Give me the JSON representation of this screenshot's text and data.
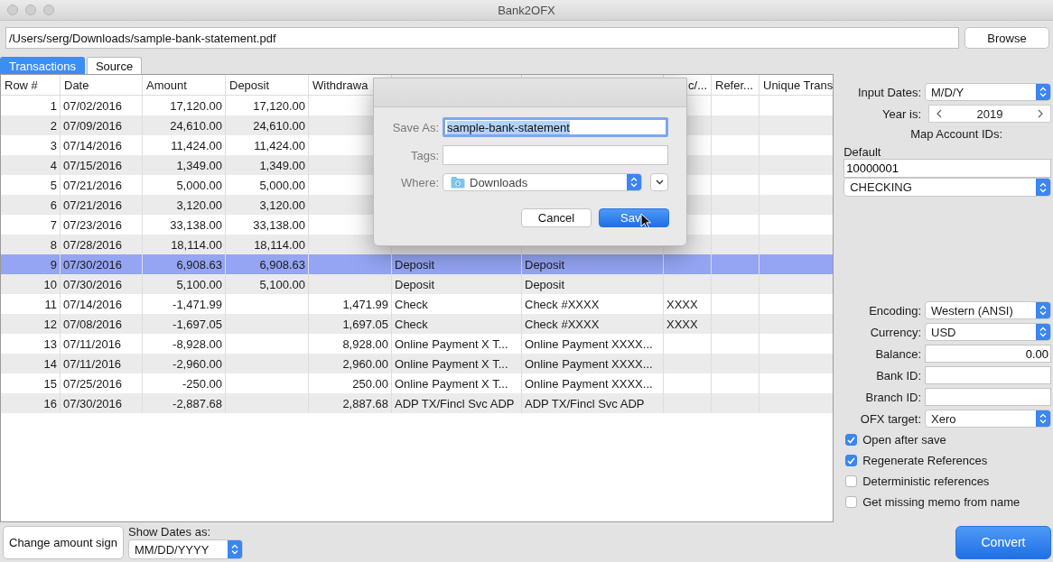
{
  "window": {
    "title": "Bank2OFX"
  },
  "file_path": {
    "value": "/Users/serg/Downloads/sample-bank-statement.pdf"
  },
  "browse_button": "Browse",
  "tabs": [
    {
      "label": "Transactions",
      "selected": true
    },
    {
      "label": "Source",
      "selected": false
    }
  ],
  "table": {
    "columns": [
      {
        "label": "Row #"
      },
      {
        "label": "Date"
      },
      {
        "label": "Amount"
      },
      {
        "label": "Deposit"
      },
      {
        "label": "Withdrawa"
      },
      {},
      {},
      {
        "label": "c/..."
      },
      {
        "label": "Refer..."
      },
      {
        "label": "Unique Trans"
      }
    ],
    "rows": [
      {
        "selected": false,
        "cells": [
          "1",
          "07/02/2016",
          "17,120.00",
          "17,120.00",
          null,
          null,
          null,
          null,
          null,
          null
        ]
      },
      {
        "selected": false,
        "cells": [
          "2",
          "07/09/2016",
          "24,610.00",
          "24,610.00",
          null,
          null,
          null,
          null,
          null,
          null
        ]
      },
      {
        "selected": false,
        "cells": [
          "3",
          "07/14/2016",
          "11,424.00",
          "11,424.00",
          null,
          null,
          null,
          null,
          null,
          null
        ]
      },
      {
        "selected": false,
        "cells": [
          "4",
          "07/15/2016",
          "1,349.00",
          "1,349.00",
          null,
          null,
          null,
          null,
          null,
          null
        ]
      },
      {
        "selected": false,
        "cells": [
          "5",
          "07/21/2016",
          "5,000.00",
          "5,000.00",
          null,
          null,
          null,
          null,
          null,
          null
        ]
      },
      {
        "selected": false,
        "cells": [
          "6",
          "07/21/2016",
          "3,120.00",
          "3,120.00",
          null,
          null,
          null,
          null,
          null,
          null
        ]
      },
      {
        "selected": false,
        "cells": [
          "7",
          "07/23/2016",
          "33,138.00",
          "33,138.00",
          null,
          null,
          null,
          null,
          null,
          null
        ]
      },
      {
        "selected": false,
        "cells": [
          "8",
          "07/28/2016",
          "18,114.00",
          "18,114.00",
          null,
          null,
          null,
          null,
          null,
          null
        ]
      },
      {
        "selected": true,
        "cells": [
          "9",
          "07/30/2016",
          "6,908.63",
          "6,908.63",
          null,
          "Deposit",
          "Deposit",
          null,
          null,
          null
        ]
      },
      {
        "selected": false,
        "cells": [
          "10",
          "07/30/2016",
          "5,100.00",
          "5,100.00",
          null,
          "Deposit",
          "Deposit",
          null,
          null,
          null
        ]
      },
      {
        "selected": false,
        "cells": [
          "11",
          "07/14/2016",
          "-1,471.99",
          null,
          "1,471.99",
          "Check",
          "Check #XXXX",
          "XXXX",
          null,
          null
        ]
      },
      {
        "selected": false,
        "cells": [
          "12",
          "07/08/2016",
          "-1,697.05",
          null,
          "1,697.05",
          "Check",
          "Check #XXXX",
          "XXXX",
          null,
          null
        ]
      },
      {
        "selected": false,
        "cells": [
          "13",
          "07/11/2016",
          "-8,928.00",
          null,
          "8,928.00",
          "Online Payment X T...",
          "Online Payment XXXX...",
          null,
          null,
          null
        ]
      },
      {
        "selected": false,
        "cells": [
          "14",
          "07/11/2016",
          "-2,960.00",
          null,
          "2,960.00",
          "Online Payment X T...",
          "Online Payment XXXX...",
          null,
          null,
          null
        ]
      },
      {
        "selected": false,
        "cells": [
          "15",
          "07/25/2016",
          "-250.00",
          null,
          "250.00",
          "Online Payment X T...",
          "Online Payment XXXX...",
          null,
          null,
          null
        ]
      },
      {
        "selected": false,
        "cells": [
          "16",
          "07/30/2016",
          "-2,887.68",
          null,
          "2,887.68",
          "ADP TX/Fincl Svc ADP",
          "ADP TX/Fincl Svc ADP",
          null,
          null,
          null
        ]
      }
    ]
  },
  "save_dialog": {
    "save_as": {
      "label": "Save As:",
      "value": "sample-bank-statement"
    },
    "tags": {
      "label": "Tags:"
    },
    "where": {
      "label": "Where:",
      "value": "Downloads"
    },
    "buttons": [
      {
        "label": "Cancel",
        "kind": "secondary"
      },
      {
        "label": "Sav",
        "kind": "primary"
      }
    ]
  },
  "settings": {
    "rows": [
      {
        "kind": "popup",
        "label": "Input Dates:",
        "value": "M/D/Y"
      },
      {
        "kind": "stepper",
        "label": "Year is:",
        "value": "2019"
      }
    ],
    "map_title": "Map Account IDs:",
    "map_label": "Default",
    "account_id": "10000001",
    "account_type": "CHECKING",
    "rows2": [
      {
        "kind": "popup",
        "label": "Encoding:",
        "value": "Western (ANSI)"
      },
      {
        "kind": "popup",
        "label": "Currency:",
        "value": "USD"
      },
      {
        "kind": "field",
        "label": "Balance:",
        "value": "0.00"
      },
      {
        "kind": "field",
        "label": "Bank ID:"
      },
      {
        "kind": "field",
        "label": "Branch ID:"
      },
      {
        "kind": "popup",
        "label": "OFX target:",
        "value": "Xero"
      }
    ],
    "checkboxes": [
      {
        "label": "Open after save",
        "checked": true
      },
      {
        "label": "Regenerate References",
        "checked": true
      },
      {
        "label": "Deterministic references",
        "checked": false
      },
      {
        "label": "Get missing memo from name",
        "checked": false
      }
    ]
  },
  "change_sign_button": "Change amount sign",
  "show_dates": {
    "label": "Show Dates as:",
    "value": "MM/DD/YYYY"
  },
  "convert_button": "Convert"
}
